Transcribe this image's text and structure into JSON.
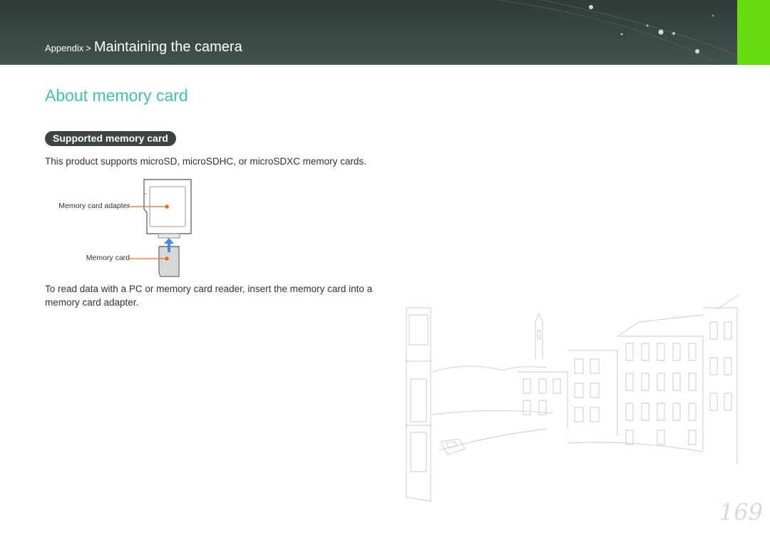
{
  "header": {
    "breadcrumb_parent": "Appendix",
    "breadcrumb_separator": ">",
    "breadcrumb_current": "Maintaining the camera",
    "banner_color": "#394845",
    "tab_color": "#66dd11"
  },
  "main": {
    "title": "About memory card",
    "title_color": "#3cc6a7",
    "section_label": "Supported memory card",
    "intro_text": "This product supports microSD, microSDHC, or microSDXC memory cards.",
    "diagram": {
      "adapter_label": "Memory card adapter",
      "card_label": "Memory card",
      "callout_color": "#f06a1e",
      "arrow_color": "#3b8fe8"
    },
    "body_text": "To read data with a PC or memory card reader, insert the memory card into a memory card adapter."
  },
  "footer": {
    "page_number": "169"
  }
}
